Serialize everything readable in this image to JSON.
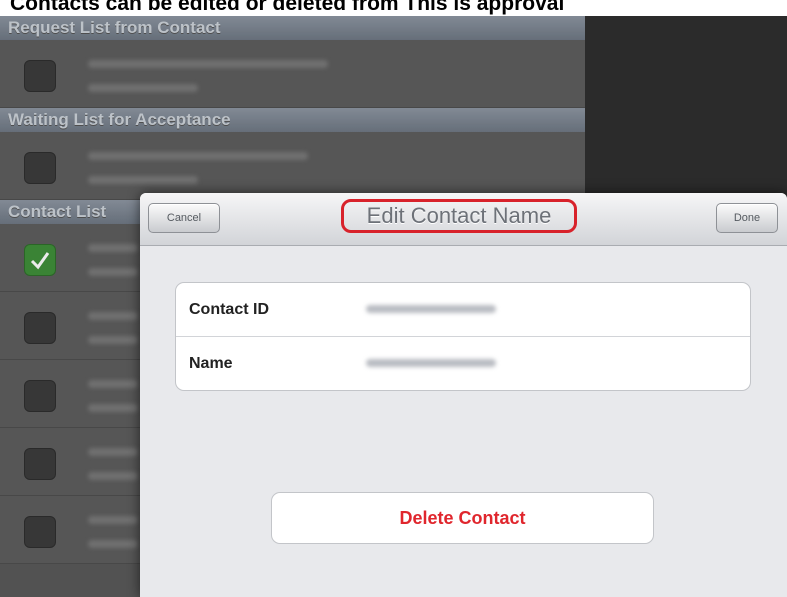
{
  "caption": "Contacts can be edited or deleted from This is approval",
  "sections": {
    "request": "Request List from Contact",
    "waiting": "Waiting List for Acceptance",
    "contact": "Contact List"
  },
  "modal": {
    "title": "Edit Contact Name",
    "cancel_label": "Cancel",
    "done_label": "Done",
    "rows": [
      {
        "label": "Contact ID"
      },
      {
        "label": "Name"
      }
    ],
    "delete_label": "Delete Contact"
  },
  "colors": {
    "highlight_border": "#d8222b",
    "delete_text": "#e0262d",
    "checked_box": "#3f8f3a"
  }
}
